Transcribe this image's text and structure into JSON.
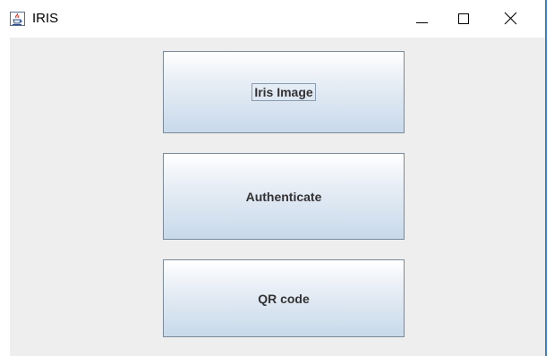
{
  "window": {
    "title": "IRIS",
    "icon": "java-cup-icon",
    "controls": [
      "minimize-icon",
      "maximize-icon",
      "close-icon"
    ]
  },
  "buttons": {
    "iris_image": "Iris Image",
    "authenticate": "Authenticate",
    "qr_code": "QR code"
  },
  "colors": {
    "content_bg": "#eeeeee",
    "button_top": "#ffffff",
    "button_bottom": "#c8d9ea",
    "button_border": "#7a8a99",
    "window_edge": "#3d7fc9"
  }
}
